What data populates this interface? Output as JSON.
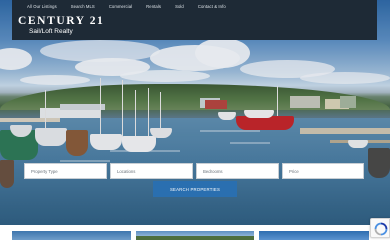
{
  "nav": {
    "links": [
      "All Our Listings",
      "Search MLS",
      "Commercial",
      "Rentals",
      "Sold",
      "Contact & Info"
    ]
  },
  "logo": {
    "brand": "CENTURY 21",
    "office": "Sail/Loft Realty"
  },
  "search": {
    "fields": [
      "Property Type",
      "Locations",
      "Bedrooms",
      "Price"
    ],
    "button_label": "SEARCH PROPERTIES"
  },
  "colors": {
    "nav_bg": "#1e2a36",
    "button_bg": "#2a6fb0"
  }
}
